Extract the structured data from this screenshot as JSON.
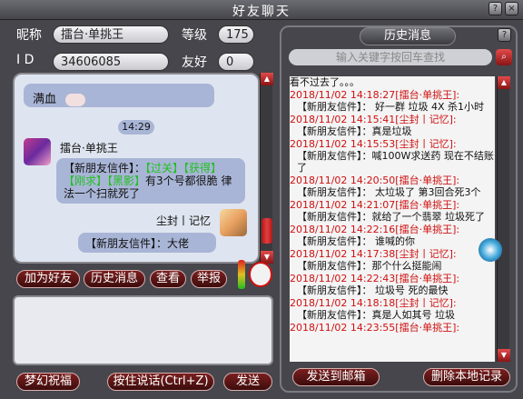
{
  "window": {
    "title": "好友聊天",
    "help": "?",
    "close": "×"
  },
  "profile": {
    "name_label": "昵称",
    "name_value": "擂台·单挑王",
    "level_label": "等级",
    "level_value": "175",
    "id_label": "I  D",
    "id_value": "34606085",
    "friend_label": "友好",
    "friend_value": "0"
  },
  "chat": {
    "first_text": "满血",
    "time_badge": "14:29",
    "sender1": "擂台·单挑王",
    "msg1": "【新朋友信件】：",
    "msg1_green": "【过关】【获得】【刚求】【黑影】",
    "msg1_tail": "有3个号都很脆 律法一个扫就死了",
    "sender2": "尘封丨记忆",
    "msg2": "【新朋友信件】：大佬"
  },
  "buttons": {
    "add_friend": "加为好友",
    "history": "历史消息",
    "view": "查看",
    "report": "举报",
    "blessing": "梦幻祝福",
    "push_to_talk": "按住说话(Ctrl+Z)",
    "send": "发送"
  },
  "history": {
    "title": "历史消息",
    "help": "?",
    "search_placeholder": "输入关键字按回车查找",
    "lines": [
      {
        "ts": "",
        "msg": "看不过去了。。。"
      },
      {
        "ts": "2018/11/02 14:18:27[擂台·单挑王]:",
        "msg": "【新朋友信件】： 好一群 垃圾 4X 杀1小时"
      },
      {
        "ts": "2018/11/02 14:15:41[尘封丨记忆]:",
        "msg": "【新朋友信件】：真是垃圾"
      },
      {
        "ts": "2018/11/02 14:15:53[尘封丨记忆]:",
        "msg": "【新朋友信件】：喊100W求送药 现在不结账了"
      },
      {
        "ts": "2018/11/02 14:20:50[擂台·单挑王]:",
        "msg": "【新朋友信件】：  太垃圾了 第3回合死3个"
      },
      {
        "ts": "2018/11/02 14:21:07[擂台·单挑王]:",
        "msg": "【新朋友信件】：就给了一个翡翠 垃圾死了"
      },
      {
        "ts": "2018/11/02 14:22:16[擂台·单挑王]:",
        "msg": "【新朋友信件】： 谁喊的你"
      },
      {
        "ts": "2018/11/02 14:17:38[尘封丨记忆]:",
        "msg": "【新朋友信件】：那个什么挺能闹"
      },
      {
        "ts": "2018/11/02 14:22:43[擂台·单挑王]:",
        "msg": "【新朋友信件】： 垃圾号   死的最快"
      },
      {
        "ts": "2018/11/02 14:18:18[尘封丨记忆]:",
        "msg": "【新朋友信件】：真是人如其号   垃圾"
      },
      {
        "ts": "2018/11/02 14:23:55[擂台·单挑王]:",
        "msg": ""
      }
    ],
    "send_mail": "发送到邮箱",
    "delete_local": "删除本地记录"
  },
  "colors": {
    "accent_red": "#d01010",
    "bubble": "#a9b5d6",
    "green_tag": "#20c020"
  }
}
